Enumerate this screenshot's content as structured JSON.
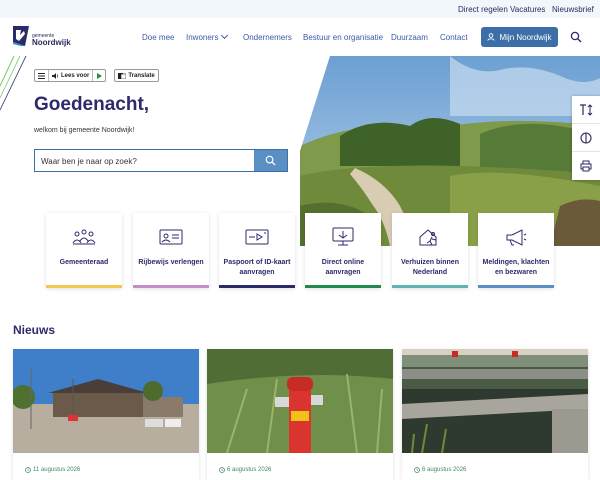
{
  "utility_links": [
    "Direct regelen",
    "Vacatures",
    "Nieuwsbrief"
  ],
  "logo": {
    "small": "gemeente",
    "name": "Noordwijk"
  },
  "nav": [
    "Doe mee",
    "Inwoners",
    "Ondernemers",
    "Bestuur en organisatie",
    "Duurzaam",
    "Contact"
  ],
  "mijn_button": "Mijn Noordwijk",
  "toolbar": {
    "read": "Lees voor",
    "translate": "Translate"
  },
  "hero": {
    "title": "Goedenacht,",
    "subtitle": "welkom bij gemeente Noordwijk!",
    "search_placeholder": "Waar ben je naar op zoek?"
  },
  "tiles": [
    {
      "label": "Gemeenteraad",
      "icon": "council-icon",
      "color": "#f2c94c"
    },
    {
      "label": "Rijbewijs verlengen",
      "icon": "id-card-icon",
      "color": "#c38fc6"
    },
    {
      "label": "Paspoort of ID-kaart aanvragen",
      "icon": "passport-icon",
      "color": "#2b2a6b"
    },
    {
      "label": "Direct online aanvragen",
      "icon": "monitor-icon",
      "color": "#1f8a4c"
    },
    {
      "label": "Verhuizen binnen Nederland",
      "icon": "moving-icon",
      "color": "#5fb3b3"
    },
    {
      "label": "Meldingen, klachten en bezwaren",
      "icon": "megaphone-icon",
      "color": "#5a8fc4"
    }
  ],
  "news": {
    "title": "Nieuws",
    "items": [
      {
        "date": "11 augustus 2026"
      },
      {
        "date": "6 augustus 2026"
      },
      {
        "date": "6 augustus 2026"
      }
    ]
  },
  "colors": {
    "primary": "#2b2a6b",
    "button": "#3c6fa7",
    "link": "#3b5aa6",
    "date": "#3e8a5e"
  }
}
